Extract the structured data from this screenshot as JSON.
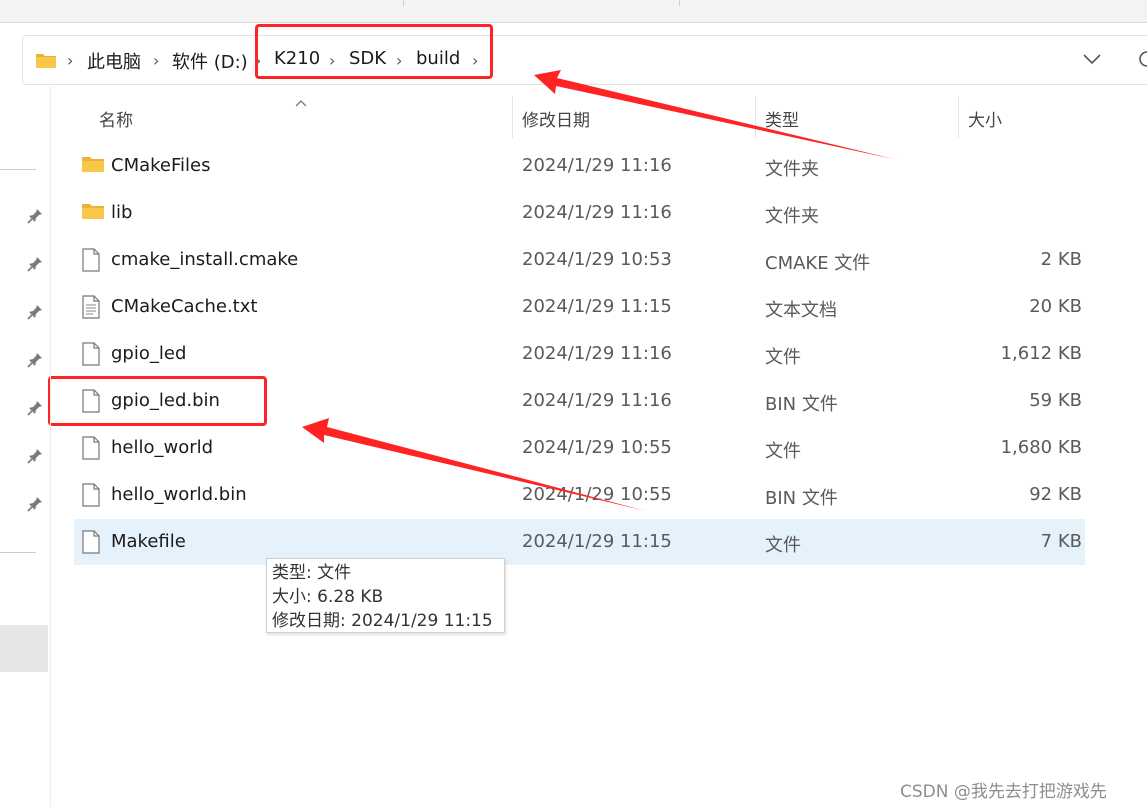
{
  "breadcrumb": {
    "items": [
      "此电脑",
      "软件 (D:)",
      "K210",
      "SDK",
      "build"
    ]
  },
  "columns": {
    "name": "名称",
    "date": "修改日期",
    "type": "类型",
    "size": "大小"
  },
  "files": [
    {
      "name": "CMakeFiles",
      "date": "2024/1/29 11:16",
      "type": "文件夹",
      "size": "",
      "icon": "folder-icon"
    },
    {
      "name": "lib",
      "date": "2024/1/29 11:16",
      "type": "文件夹",
      "size": "",
      "icon": "folder-icon"
    },
    {
      "name": "cmake_install.cmake",
      "date": "2024/1/29 10:53",
      "type": "CMAKE 文件",
      "size": "2 KB",
      "icon": "file-icon"
    },
    {
      "name": "CMakeCache.txt",
      "date": "2024/1/29 11:15",
      "type": "文本文档",
      "size": "20 KB",
      "icon": "text-file-icon"
    },
    {
      "name": "gpio_led",
      "date": "2024/1/29 11:16",
      "type": "文件",
      "size": "1,612 KB",
      "icon": "file-icon"
    },
    {
      "name": "gpio_led.bin",
      "date": "2024/1/29 11:16",
      "type": "BIN 文件",
      "size": "59 KB",
      "icon": "file-icon"
    },
    {
      "name": "hello_world",
      "date": "2024/1/29 10:55",
      "type": "文件",
      "size": "1,680 KB",
      "icon": "file-icon"
    },
    {
      "name": "hello_world.bin",
      "date": "2024/1/29 10:55",
      "type": "BIN 文件",
      "size": "92 KB",
      "icon": "file-icon"
    },
    {
      "name": "Makefile",
      "date": "2024/1/29 11:15",
      "type": "文件",
      "size": "7 KB",
      "icon": "file-icon",
      "selected": true
    }
  ],
  "tooltip": {
    "type_line": "类型: 文件",
    "size_line": "大小: 6.28 KB",
    "date_line": "修改日期: 2024/1/29 11:15"
  },
  "watermark": "CSDN @我先去打把游戏先",
  "colors": {
    "annotation_red": "#ff2323",
    "selection_bg": "#e5f1fb",
    "folder_yellow": "#f8c74a"
  }
}
